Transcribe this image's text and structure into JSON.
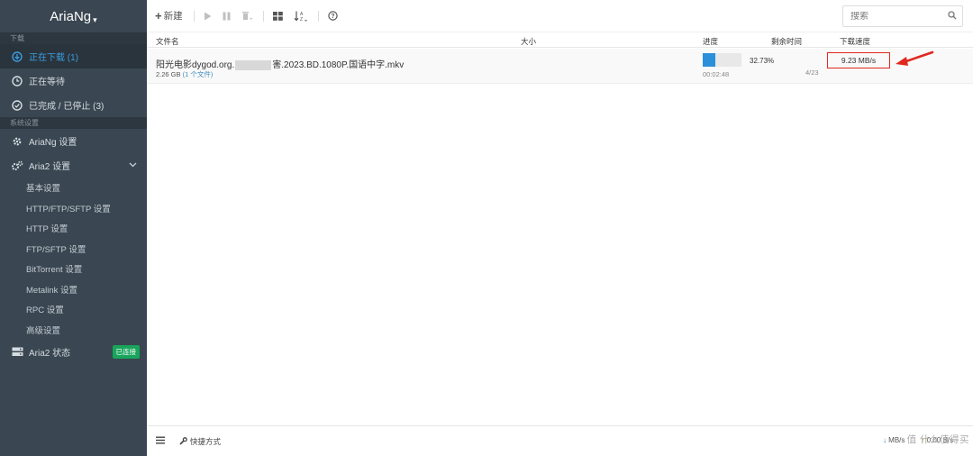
{
  "app": {
    "title": "AriaNg",
    "title_mark": "▾"
  },
  "sidebar": {
    "sec_download": "下载",
    "sec_settings": "系统设置",
    "download_items": [
      {
        "label": "正在下载 (1)",
        "icon": "download-circle-icon"
      },
      {
        "label": "正在等待",
        "icon": "clock-icon"
      },
      {
        "label": "已完成 / 已停止 (3)",
        "icon": "check-circle-icon"
      }
    ],
    "ariang_settings": "AriaNg 设置",
    "aria2_settings": "Aria2 设置",
    "aria2_sub": [
      "基本设置",
      "HTTP/FTP/SFTP 设置",
      "HTTP 设置",
      "FTP/SFTP 设置",
      "BitTorrent 设置",
      "Metalink 设置",
      "RPC 设置",
      "高级设置"
    ],
    "aria2_status": "Aria2 状态",
    "status_badge": "已连接"
  },
  "toolbar": {
    "new_label": "新建",
    "search_placeholder": "搜索"
  },
  "table": {
    "headers": {
      "name": "文件名",
      "size": "大小",
      "progress": "进度",
      "remaining": "剩余时间",
      "speed": "下载速度"
    }
  },
  "task": {
    "name_prefix": "阳光电影dygod.org.",
    "name_suffix": "害.2023.BD.1080P.国语中字.mkv",
    "size": "2.26 GB",
    "files": "(1 个文件)",
    "progress_text": "32.73%",
    "progress": 0.3273,
    "time": "00:02:48",
    "connections": "4/23",
    "speed": "9.23 MB/s"
  },
  "footer": {
    "shortcut": "快捷方式",
    "down_rate": "MB/s",
    "up_rate": "0.00 B/s",
    "watermark": "值 什么值得买"
  },
  "colors": {
    "sidebar": "#3a4651",
    "accent": "#3c9ce0",
    "progress": "#2b8fd9",
    "badge": "#18a55b",
    "highlight": "#e0281e"
  }
}
